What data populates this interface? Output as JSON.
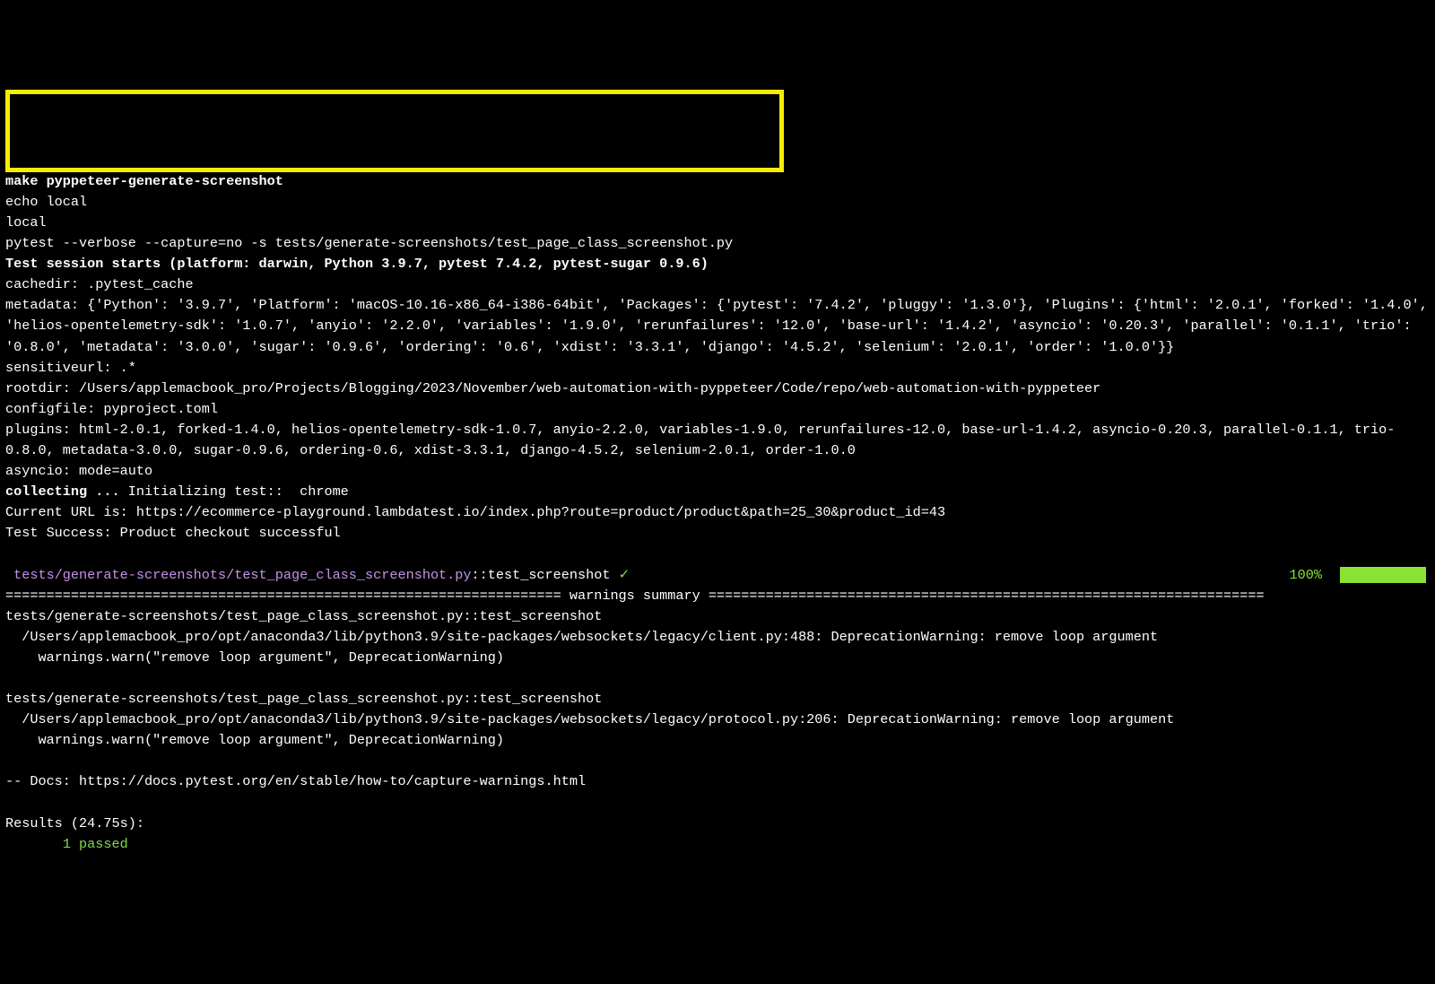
{
  "command_block": {
    "line1": "make pyppeteer-generate-screenshot",
    "line2": "echo local",
    "line3": "local",
    "line4": "pytest --verbose --capture=no -s tests/generate-screenshots/test_page_class_screenshot.py"
  },
  "session": {
    "header": "Test session starts (platform: darwin, Python 3.9.7, pytest 7.4.2, pytest-sugar 0.9.6)",
    "cachedir": "cachedir: .pytest_cache",
    "metadata": "metadata: {'Python': '3.9.7', 'Platform': 'macOS-10.16-x86_64-i386-64bit', 'Packages': {'pytest': '7.4.2', 'pluggy': '1.3.0'}, 'Plugins': {'html': '2.0.1', 'forked': '1.4.0', 'helios-opentelemetry-sdk': '1.0.7', 'anyio': '2.2.0', 'variables': '1.9.0', 'rerunfailures': '12.0', 'base-url': '1.4.2', 'asyncio': '0.20.3', 'parallel': '0.1.1', 'trio': '0.8.0', 'metadata': '3.0.0', 'sugar': '0.9.6', 'ordering': '0.6', 'xdist': '3.3.1', 'django': '4.5.2', 'selenium': '2.0.1', 'order': '1.0.0'}}",
    "sensitiveurl": "sensitiveurl: .*",
    "rootdir": "rootdir: /Users/applemacbook_pro/Projects/Blogging/2023/November/web-automation-with-pyppeteer/Code/repo/web-automation-with-pyppeteer",
    "configfile": "configfile: pyproject.toml",
    "plugins": "plugins: html-2.0.1, forked-1.4.0, helios-opentelemetry-sdk-1.0.7, anyio-2.2.0, variables-1.9.0, rerunfailures-12.0, base-url-1.4.2, asyncio-0.20.3, parallel-0.1.1, trio-0.8.0, metadata-3.0.0, sugar-0.9.6, ordering-0.6, xdist-3.3.1, django-4.5.2, selenium-2.0.1, order-1.0.0",
    "asyncio": "asyncio: mode=auto"
  },
  "collecting": {
    "label": "collecting ... ",
    "init": "Initializing test::  chrome"
  },
  "runtime": {
    "url_line": "Current URL is: https://ecommerce-playground.lambdatest.io/index.php?route=product/product&path=25_30&product_id=43",
    "success_line": "Test Success: Product checkout successful"
  },
  "test_result": {
    "path": " tests/generate-screenshots/test_page_class_screenshot.py",
    "sep": "::",
    "name": "test_screenshot",
    "check": "✓",
    "percent": "100%"
  },
  "warnings": {
    "divider_left": "==================================================================== ",
    "title": "warnings summary",
    "divider_right": " ====================================================================",
    "w1": {
      "header": "tests/generate-screenshots/test_page_class_screenshot.py::test_screenshot",
      "loc": "  /Users/applemacbook_pro/opt/anaconda3/lib/python3.9/site-packages/websockets/legacy/client.py:488: DeprecationWarning: remove loop argument",
      "code": "    warnings.warn(\"remove loop argument\", DeprecationWarning)"
    },
    "w2": {
      "header": "tests/generate-screenshots/test_page_class_screenshot.py::test_screenshot",
      "loc": "  /Users/applemacbook_pro/opt/anaconda3/lib/python3.9/site-packages/websockets/legacy/protocol.py:206: DeprecationWarning: remove loop argument",
      "code": "    warnings.warn(\"remove loop argument\", DeprecationWarning)"
    },
    "docs": "-- Docs: https://docs.pytest.org/en/stable/how-to/capture-warnings.html"
  },
  "results": {
    "header": "Results (24.75s):",
    "passed_count": "       1 passed"
  },
  "colors": {
    "highlight_border": "#f5ed00",
    "green": "#7fdd4c",
    "purple": "#c792ea",
    "progress_green": "#8ae234"
  }
}
